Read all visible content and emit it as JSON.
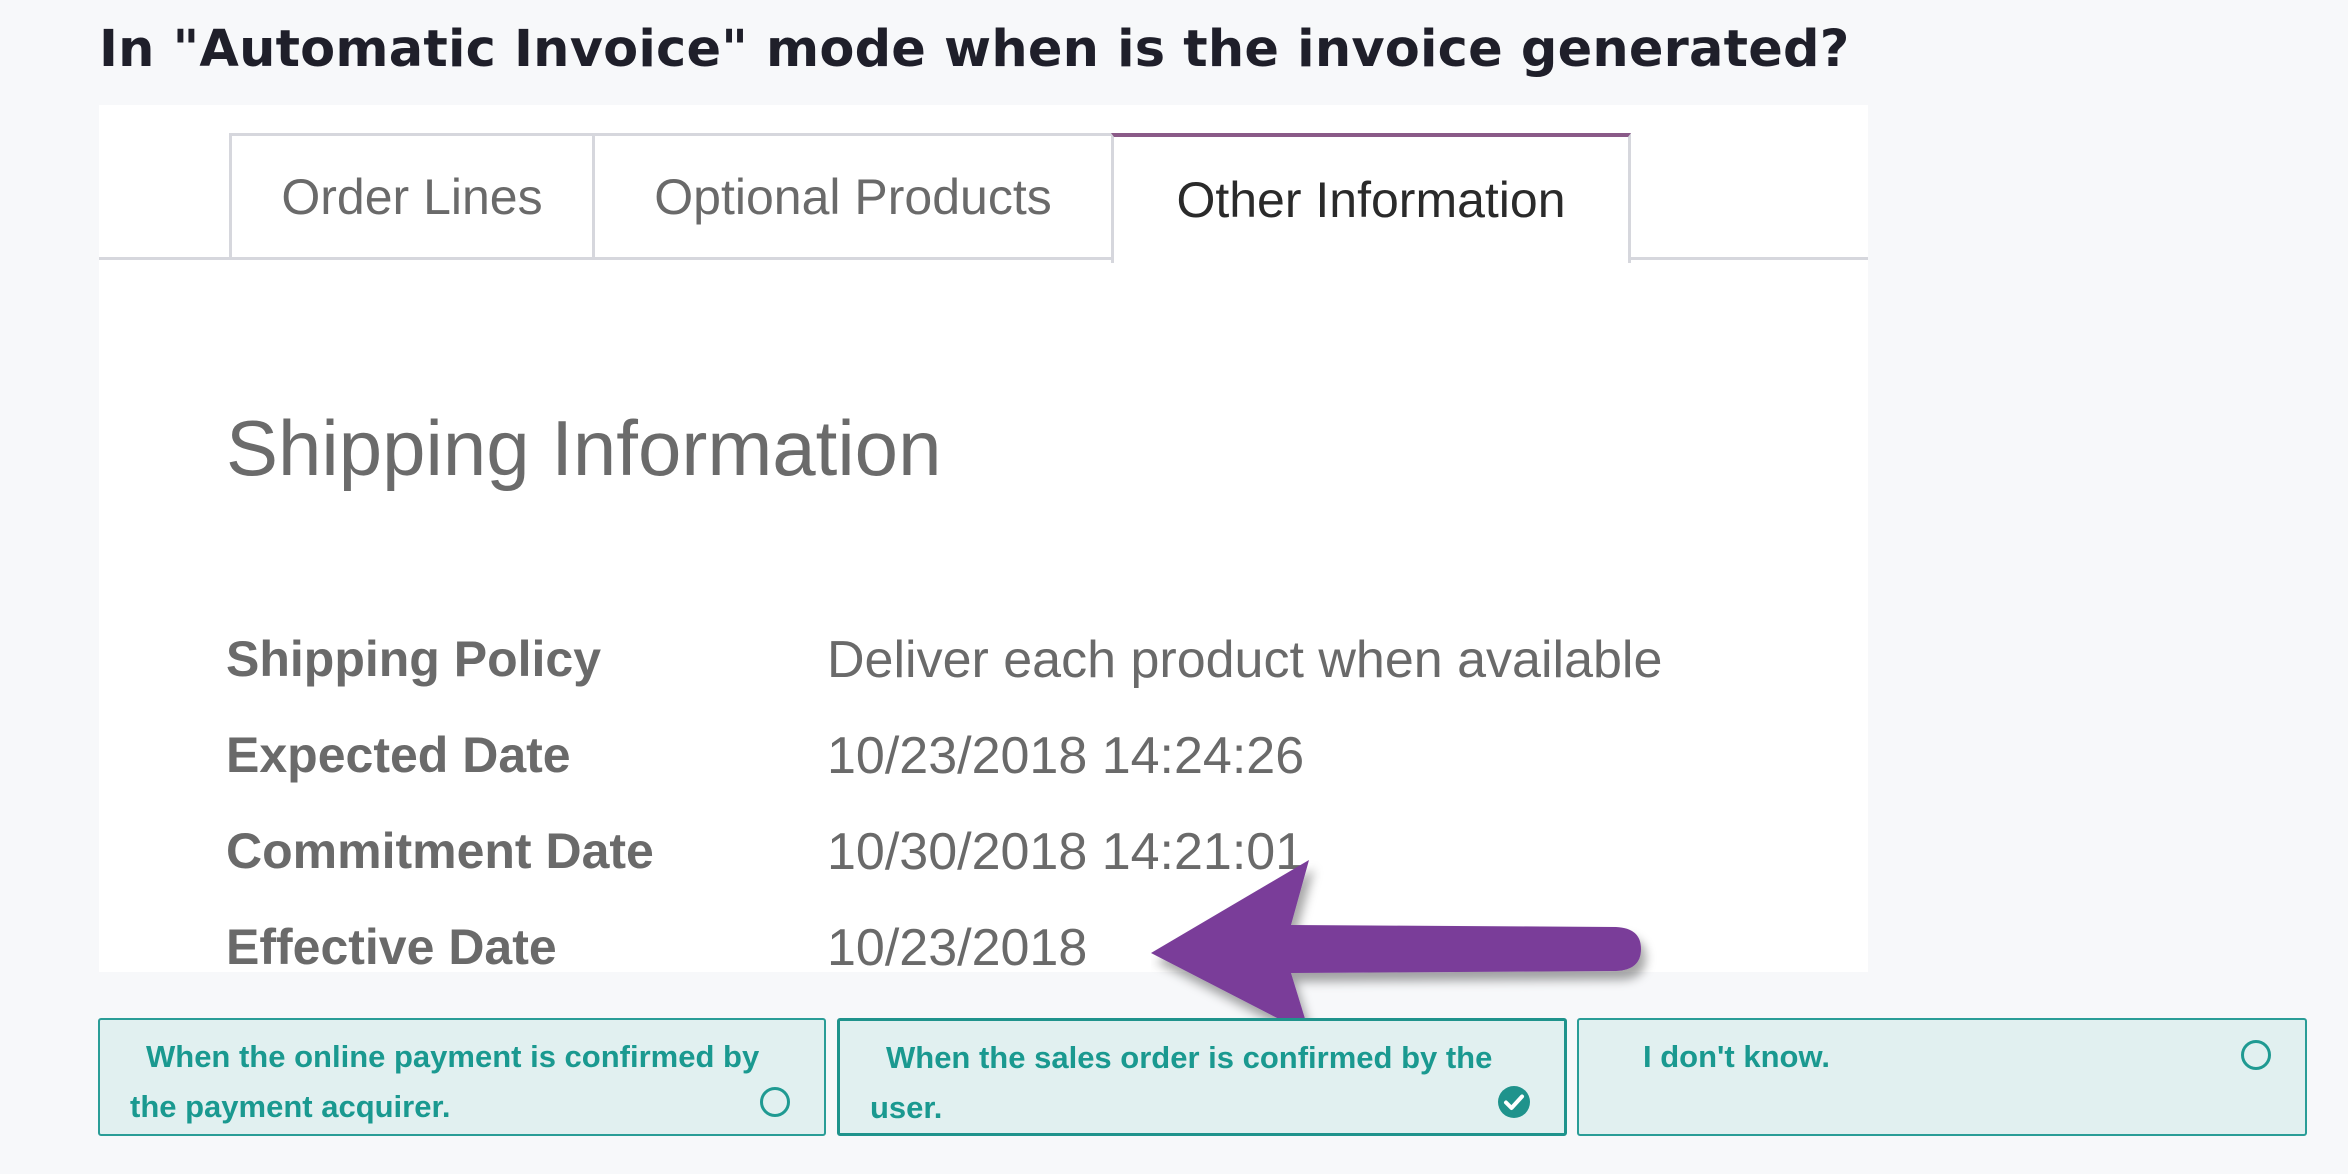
{
  "question": {
    "text": "In \"Automatic Invoice\" mode when is the invoice generated?"
  },
  "screenshot": {
    "tabs": [
      {
        "label": "Order Lines"
      },
      {
        "label": "Optional Products"
      },
      {
        "label": "Other Information",
        "active": true
      }
    ],
    "section_title": "Shipping Information",
    "fields": [
      {
        "label": "Shipping Policy",
        "value": "Deliver each product when available"
      },
      {
        "label": "Expected Date",
        "value": "10/23/2018 14:24:26"
      },
      {
        "label": "Commitment Date",
        "value": "10/30/2018 14:21:01"
      },
      {
        "label": "Effective Date",
        "value": "10/23/2018"
      }
    ],
    "arrow_color": "#7a3d99",
    "active_tab_accent": "#8a5a88"
  },
  "answers": [
    {
      "label": "When the online payment is confirmed by the payment acquirer.",
      "selected": false,
      "icon": "radio-unchecked-icon"
    },
    {
      "label": "When the sales order is confirmed by the user.",
      "selected": true,
      "icon": "check-circle-icon"
    },
    {
      "label": "I don't know.",
      "selected": false,
      "icon": "radio-unchecked-icon"
    }
  ],
  "colors": {
    "accent": "#1a9990",
    "answer_background": "#e1f0f0",
    "page_background": "#f7f8fa"
  }
}
